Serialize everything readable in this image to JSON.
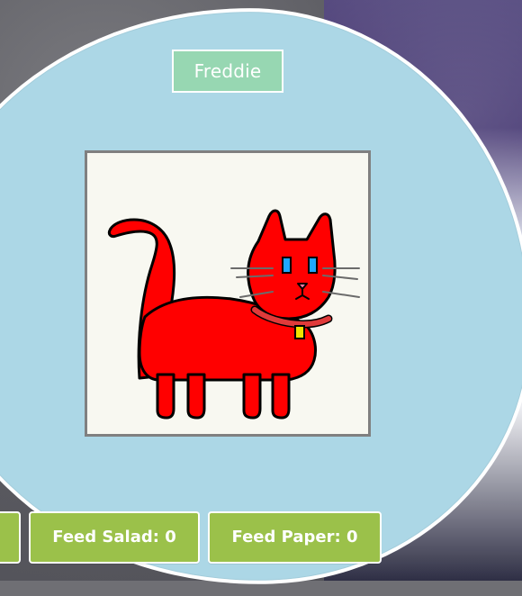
{
  "pet": {
    "name": "Freddie",
    "image_icon": "red-cat-pixel-art"
  },
  "actions": {
    "feed_salad_label": "Feed Salad: 0",
    "feed_paper_label": "Feed Paper: 0"
  },
  "colors": {
    "bubble": "#acd7e6",
    "name_badge": "#97d7b2",
    "button": "#9bc14a",
    "frame_border": "#808080",
    "frame_bg": "#f8f8f1",
    "cat_red": "#ff0000",
    "cat_outline": "#000000",
    "eye": "#1ea7ff",
    "collar": "#e03a3a",
    "bell": "#f2e100"
  }
}
